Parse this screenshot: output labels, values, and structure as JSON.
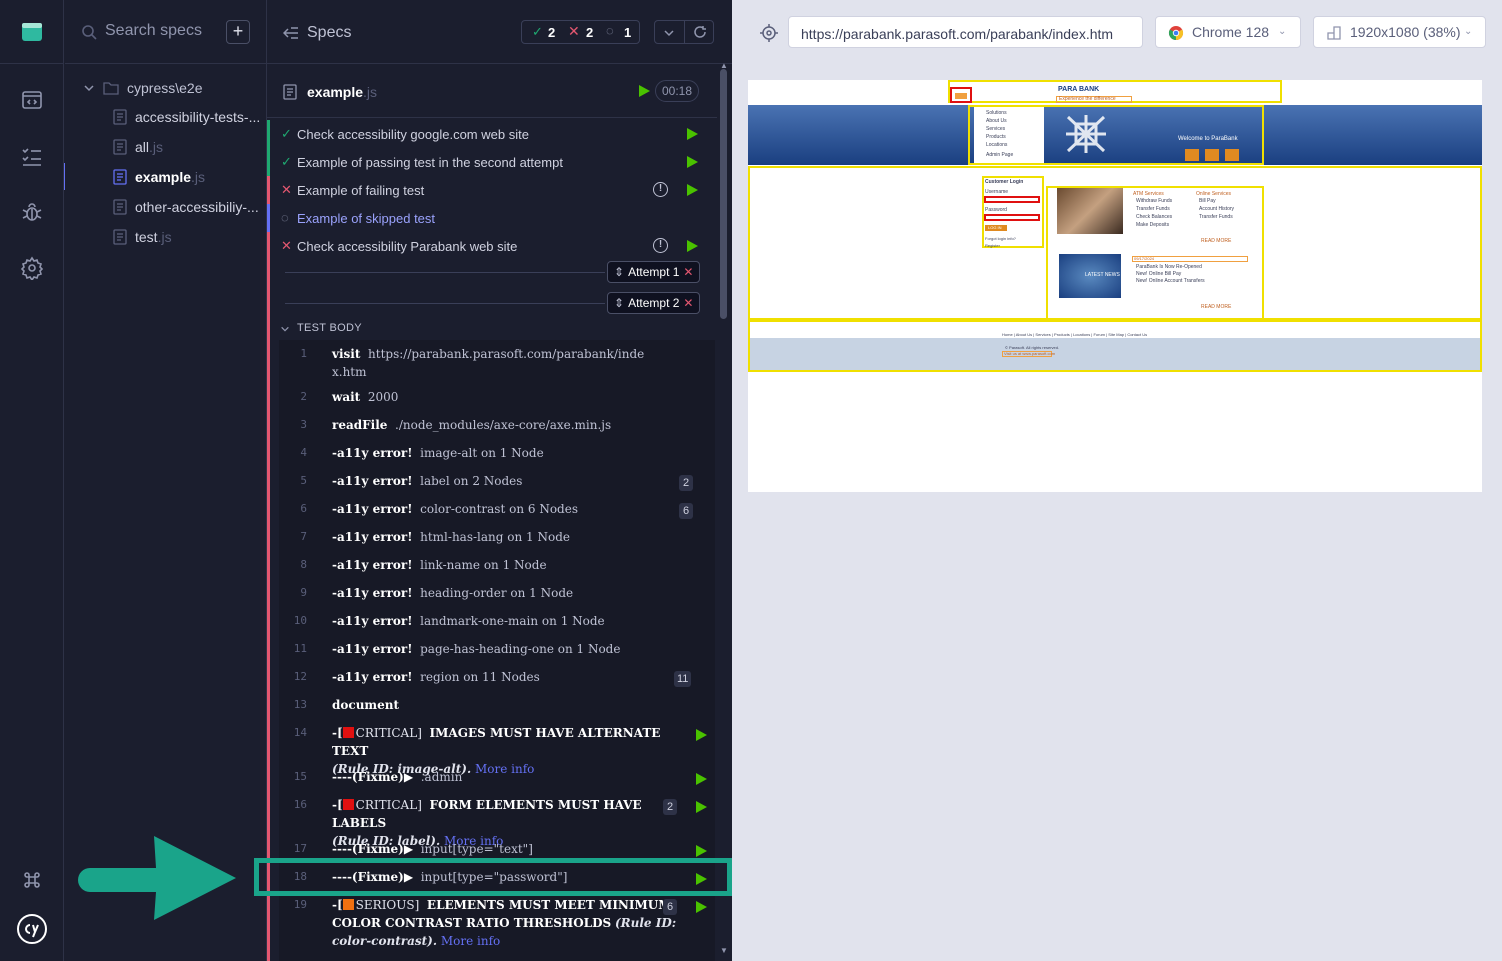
{
  "sidebar": {
    "search_placeholder": "Search specs",
    "add_label": "+",
    "folder": "cypress\\e2e",
    "files": [
      {
        "name": "accessibility-tests-...",
        "ext": ""
      },
      {
        "name": "all",
        "ext": ".js"
      },
      {
        "name": "example",
        "ext": ".js"
      },
      {
        "name": "other-accessibiliy-...",
        "ext": ""
      },
      {
        "name": "test",
        "ext": ".js"
      }
    ]
  },
  "reporter": {
    "title": "Specs",
    "stats": {
      "passed": "2",
      "failed": "2",
      "pending": "1"
    },
    "spec": {
      "name": "example",
      "ext": ".js",
      "duration": "00:18"
    },
    "tests": [
      {
        "label": "Check accessibility google.com web site",
        "state": "passed"
      },
      {
        "label": "Example of passing test in the second attempt",
        "state": "passed"
      },
      {
        "label": "Example of failing test",
        "state": "failed"
      },
      {
        "label": "Example of skipped test",
        "state": "skipped"
      },
      {
        "label": "Check accessibility Parabank web site",
        "state": "failed"
      }
    ],
    "attempts": [
      "Attempt 1",
      "Attempt 2"
    ],
    "test_body_label": "TEST BODY",
    "commands": [
      {
        "n": "1",
        "name": "visit",
        "msg": "https://parabank.parasoft.com/parabank/inde",
        "msg2": "x.htm"
      },
      {
        "n": "2",
        "name": "wait",
        "msg": "2000"
      },
      {
        "n": "3",
        "name": "readFile",
        "msg": "./node_modules/axe-core/axe.min.js"
      },
      {
        "n": "4",
        "name": "-a11y error!",
        "msg": "image-alt on 1 Node"
      },
      {
        "n": "5",
        "name": "-a11y error!",
        "msg": "label on 2 Nodes",
        "badge": "2"
      },
      {
        "n": "6",
        "name": "-a11y error!",
        "msg": "color-contrast on 6 Nodes",
        "badge": "6"
      },
      {
        "n": "7",
        "name": "-a11y error!",
        "msg": "html-has-lang on 1 Node"
      },
      {
        "n": "8",
        "name": "-a11y error!",
        "msg": "link-name on 1 Node"
      },
      {
        "n": "9",
        "name": "-a11y error!",
        "msg": "heading-order on 1 Node"
      },
      {
        "n": "10",
        "name": "-a11y error!",
        "msg": "landmark-one-main on 1 Node"
      },
      {
        "n": "11",
        "name": "-a11y error!",
        "msg": "page-has-heading-one on 1 Node"
      },
      {
        "n": "12",
        "name": "-a11y error!",
        "msg": "region on 11 Nodes",
        "badge": "11"
      },
      {
        "n": "13",
        "name": "document",
        "msg": ""
      }
    ],
    "log14": {
      "n": "14",
      "sev": "CRITICAL]",
      "title": "IMAGES MUST HAVE ALTERNATE TEXT",
      "rule": "(Rule ID: image-alt).",
      "more": "More info"
    },
    "log15": {
      "n": "15",
      "fix": "(Fixme)",
      "sel": ".admin"
    },
    "log16": {
      "n": "16",
      "sev": "CRITICAL]",
      "title": "FORM ELEMENTS MUST HAVE LABELS",
      "rule": "(Rule ID: label).",
      "more": "More info",
      "badge": "2"
    },
    "log17": {
      "n": "17",
      "fix": "(Fixme)",
      "sel": "input[type=\"text\"]"
    },
    "log18": {
      "n": "18",
      "fix": "(Fixme)",
      "sel": "input[type=\"password\"]"
    },
    "log19": {
      "n": "19",
      "sev": "SERIOUS]",
      "title": "ELEMENTS MUST MEET MINIMUM",
      "title2": "COLOR CONTRAST RATIO THRESHOLDS",
      "rule": "(Rule ID:",
      "rule2": "color-contrast).",
      "more": "More info",
      "badge": "6"
    }
  },
  "preview": {
    "url": "https://parabank.parasoft.com/parabank/index.htm",
    "browser": "Chrome 128",
    "viewport": "1920x1080 (38%)",
    "site": {
      "brand": "PARA BANK",
      "tagline": "Experience the difference",
      "menu": [
        "Solutions",
        "About Us",
        "Services",
        "Products",
        "Locations",
        "Admin Page"
      ],
      "welcome": "Welcome to ParaBank",
      "login_title": "Customer Login",
      "username": "Username",
      "password": "Password",
      "login_btn": "LOG IN",
      "forgot": "Forgot login info?",
      "register": "Register",
      "atm_title": "ATM Services",
      "atm_items": [
        "Withdraw Funds",
        "Transfer Funds",
        "Check Balances",
        "Make Deposits"
      ],
      "online_title": "Online Services",
      "online_items": [
        "Bill Pay",
        "Account History",
        "Transfer Funds"
      ],
      "read_more": "READ MORE",
      "latest_news": "LATEST NEWS",
      "news_date": "09/17/2024",
      "news_items": [
        "ParaBank Is Now Re-Opened",
        "New! Online Bill Pay",
        "New! Online Account Transfers"
      ],
      "footer_links": "Home  |  About Us  |  Services  |  Products  |  Locations  |  Forum  |  Site Map  |  Contact Us",
      "copyright": "© Parasoft. All rights reserved.",
      "visit": "Visit us at www.parasoft.com"
    }
  },
  "colors": {
    "accent": "#6470f3",
    "pass": "#1fa971",
    "fail": "#e45770",
    "teal": "#1aa48a",
    "play": "#4ac200"
  }
}
